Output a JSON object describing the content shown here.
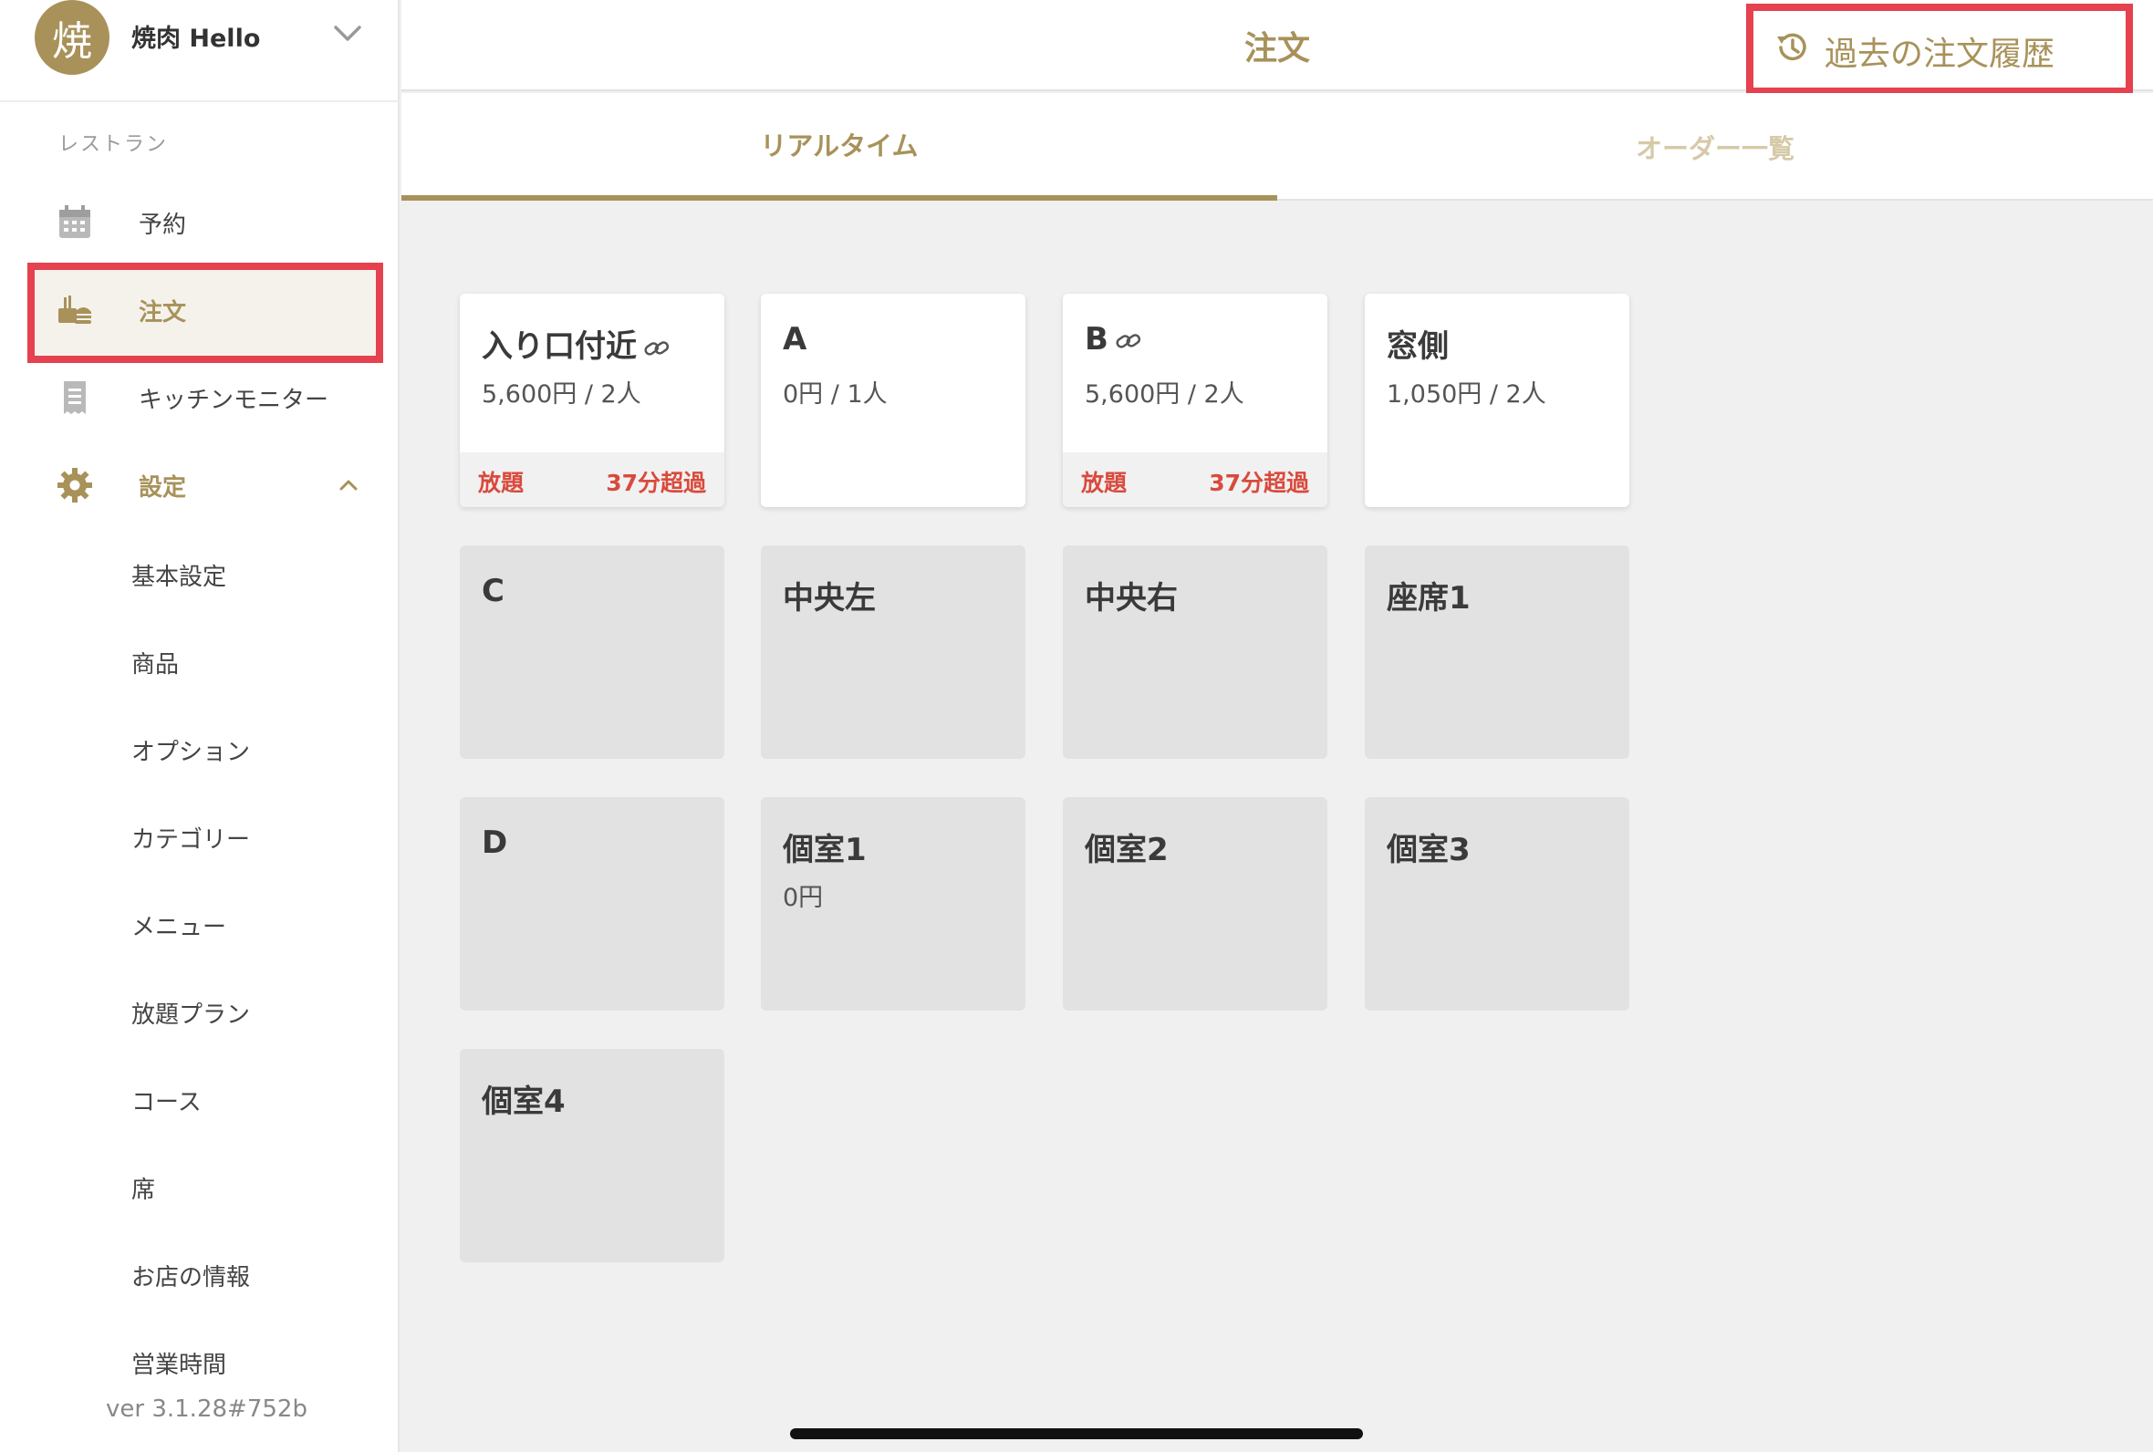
{
  "account": {
    "avatar_char": "焼",
    "name": "焼肉 Hello"
  },
  "sidebar": {
    "section_label": "レストラン",
    "items": [
      {
        "label": "予約",
        "icon": "calendar-icon"
      },
      {
        "label": "注文",
        "icon": "order-tray-icon"
      },
      {
        "label": "キッチンモニター",
        "icon": "receipt-icon"
      },
      {
        "label": "設定",
        "icon": "gear-icon"
      }
    ],
    "settings_items": [
      "基本設定",
      "商品",
      "オプション",
      "カテゴリー",
      "メニュー",
      "放題プラン",
      "コース",
      "席",
      "お店の情報",
      "営業時間"
    ],
    "version": "ver 3.1.28#752b"
  },
  "header": {
    "title": "注文",
    "history_button": "過去の注文履歴"
  },
  "tabs": {
    "realtime": "リアルタイム",
    "order_list": "オーダー一覧"
  },
  "tables": [
    {
      "name": "入り口付近",
      "linked": true,
      "info": "5,600円 / 2人",
      "tag": "放題",
      "status": "37分超過",
      "active": true
    },
    {
      "name": "A",
      "linked": false,
      "info": "0円 / 1人",
      "tag": "",
      "status": "",
      "active": true
    },
    {
      "name": "B",
      "linked": true,
      "info": "5,600円 / 2人",
      "tag": "放題",
      "status": "37分超過",
      "active": true
    },
    {
      "name": "窓側",
      "linked": false,
      "info": "1,050円 / 2人",
      "tag": "",
      "status": "",
      "active": true
    },
    {
      "name": "C",
      "linked": false,
      "info": "",
      "tag": "",
      "status": "",
      "active": false
    },
    {
      "name": "中央左",
      "linked": false,
      "info": "",
      "tag": "",
      "status": "",
      "active": false
    },
    {
      "name": "中央右",
      "linked": false,
      "info": "",
      "tag": "",
      "status": "",
      "active": false
    },
    {
      "name": "座席1",
      "linked": false,
      "info": "",
      "tag": "",
      "status": "",
      "active": false
    },
    {
      "name": "D",
      "linked": false,
      "info": "",
      "tag": "",
      "status": "",
      "active": false
    },
    {
      "name": "個室1",
      "linked": false,
      "info": "0円",
      "tag": "",
      "status": "",
      "active": false
    },
    {
      "name": "個室2",
      "linked": false,
      "info": "",
      "tag": "",
      "status": "",
      "active": false
    },
    {
      "name": "個室3",
      "linked": false,
      "info": "",
      "tag": "",
      "status": "",
      "active": false
    },
    {
      "name": "個室4",
      "linked": false,
      "info": "",
      "tag": "",
      "status": "",
      "active": false
    }
  ],
  "colors": {
    "accent": "#a8925a",
    "alert": "#d94a3c",
    "highlight": "#e5414f"
  }
}
